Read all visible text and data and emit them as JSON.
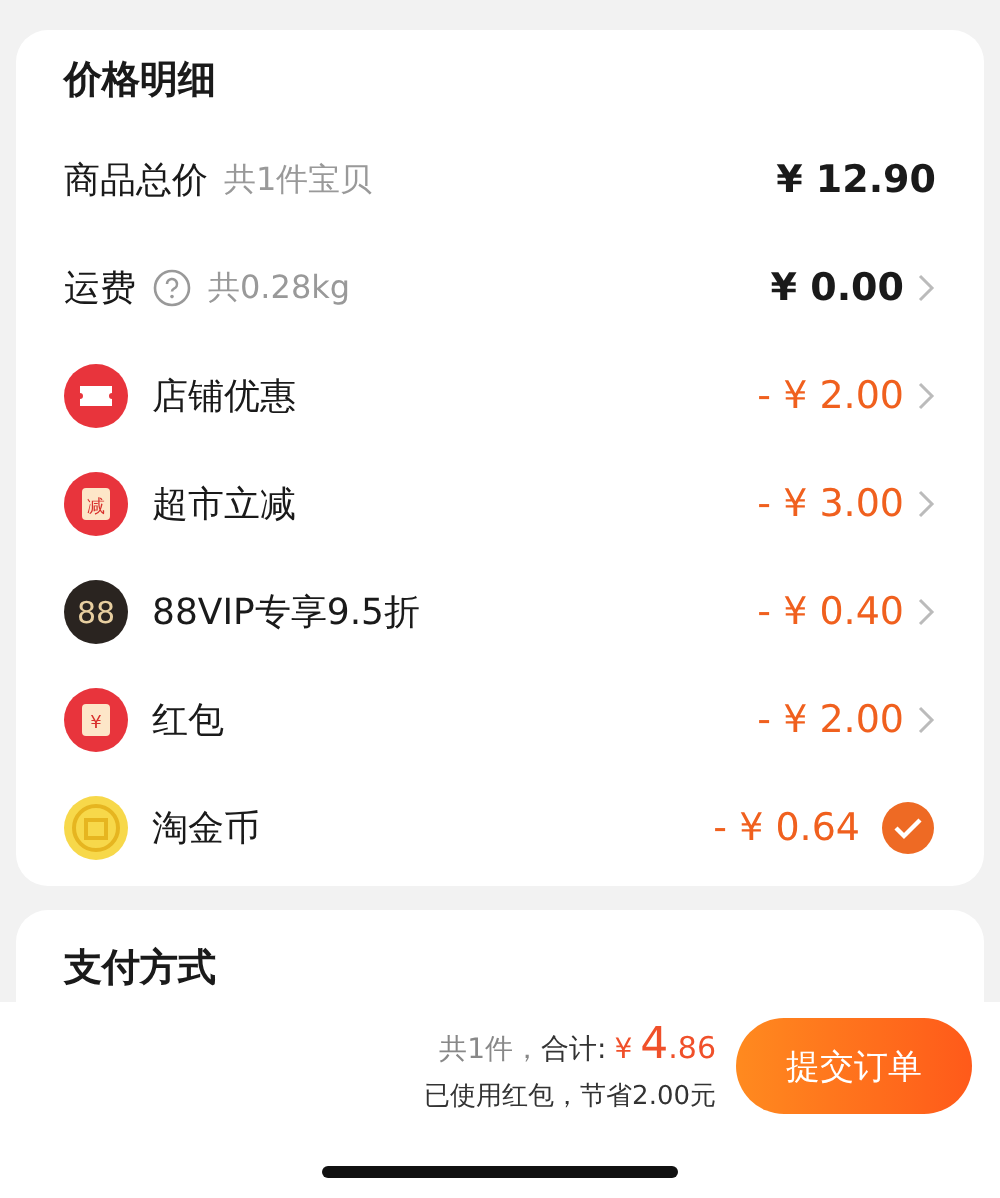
{
  "price_detail": {
    "title": "价格明细",
    "rows": [
      {
        "kind": "plain",
        "label": "商品总价",
        "note": "共1件宝贝",
        "amount": "¥ 12.90",
        "discount": false,
        "chevron": false
      },
      {
        "kind": "plain",
        "label": "运费",
        "help": true,
        "note": "共0.28kg",
        "amount": "¥ 0.00",
        "discount": false,
        "chevron": true
      },
      {
        "kind": "ticket",
        "label": "店铺优惠",
        "amount": "- ¥ 2.00",
        "discount": true,
        "chevron": true
      },
      {
        "kind": "card",
        "icon_text": "减",
        "label": "超市立减",
        "amount": "- ¥ 3.00",
        "discount": true,
        "chevron": true
      },
      {
        "kind": "vip",
        "icon_text": "88",
        "label": "88VIP专享9.5折",
        "amount": "- ¥ 0.40",
        "discount": true,
        "chevron": true
      },
      {
        "kind": "card",
        "icon_text": "¥",
        "label": "红包",
        "amount": "- ¥ 2.00",
        "discount": true,
        "chevron": true
      },
      {
        "kind": "coin",
        "label": "淘金币",
        "amount": "- ¥ 0.64",
        "discount": true,
        "checked": true
      }
    ]
  },
  "payment": {
    "title": "支付方式"
  },
  "footer": {
    "count": "共1件，",
    "total_label": "合计:",
    "currency": "¥",
    "total_int": "4",
    "total_dec": ".86",
    "savings": "已使用红包，节省2.00元",
    "submit": "提交订单"
  }
}
